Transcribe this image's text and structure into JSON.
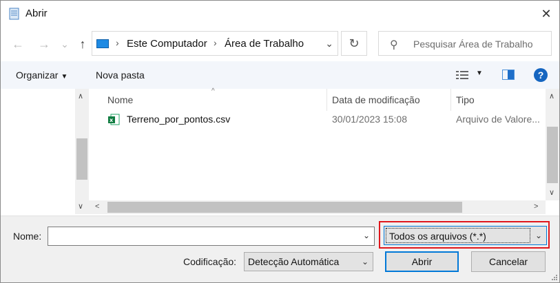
{
  "window": {
    "title": "Abrir",
    "close_glyph": "✕"
  },
  "nav": {
    "back_glyph": "←",
    "forward_glyph": "→",
    "recent_glyph": "⌄",
    "up_glyph": "↑",
    "breadcrumb": [
      "Este Computador",
      "Área de Trabalho"
    ],
    "breadcrumb_sep": "›",
    "address_drop_glyph": "⌄",
    "refresh_glyph": "↻",
    "search_placeholder": "Pesquisar Área de Trabalho",
    "search_glyph": "⚲"
  },
  "toolbar": {
    "organize_label": "Organizar",
    "organize_caret": "▼",
    "new_folder_label": "Nova pasta",
    "view_drop_glyph": "▼",
    "help_glyph": "?"
  },
  "file_list": {
    "columns": [
      "Nome",
      "Data de modificação",
      "Tipo"
    ],
    "sort_glyph": "^",
    "rows": [
      {
        "name": "Terreno_por_pontos.csv",
        "date": "30/01/2023 15:08",
        "type": "Arquivo de Valore..."
      }
    ]
  },
  "scroll": {
    "up": "∧",
    "down": "∨",
    "left": "<",
    "right": ">"
  },
  "bottom": {
    "name_label": "Nome:",
    "name_value": "",
    "filter_value": "Todos os arquivos  (*.*)",
    "encoding_label": "Codificação:",
    "encoding_value": "Detecção Automática",
    "open_label": "Abrir",
    "cancel_label": "Cancelar",
    "drop_glyph": "⌄"
  },
  "colors": {
    "accent": "#0078d7",
    "highlight_box": "#e0161b",
    "toolbar_bg": "#f3f6fb"
  }
}
